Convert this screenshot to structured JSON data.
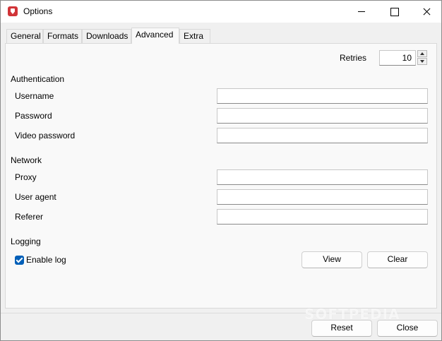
{
  "window": {
    "title": "Options"
  },
  "tabs": [
    "General",
    "Formats",
    "Downloads",
    "Advanced",
    "Extra"
  ],
  "retries": {
    "label": "Retries",
    "value": "10"
  },
  "authentication": {
    "title": "Authentication",
    "username_label": "Username",
    "password_label": "Password",
    "video_password_label": "Video password",
    "username_value": "",
    "password_value": "",
    "video_password_value": ""
  },
  "network": {
    "title": "Network",
    "proxy_label": "Proxy",
    "user_agent_label": "User agent",
    "referer_label": "Referer",
    "proxy_value": "",
    "user_agent_value": "",
    "referer_value": ""
  },
  "logging": {
    "title": "Logging",
    "enable_log_label": "Enable log",
    "enable_log_checked": true,
    "view_label": "View",
    "clear_label": "Clear"
  },
  "footer": {
    "reset_label": "Reset",
    "close_label": "Close"
  },
  "watermark": "SOFTPEDIA",
  "colors": {
    "accent": "#005fb8",
    "app_icon": "#d13438"
  }
}
